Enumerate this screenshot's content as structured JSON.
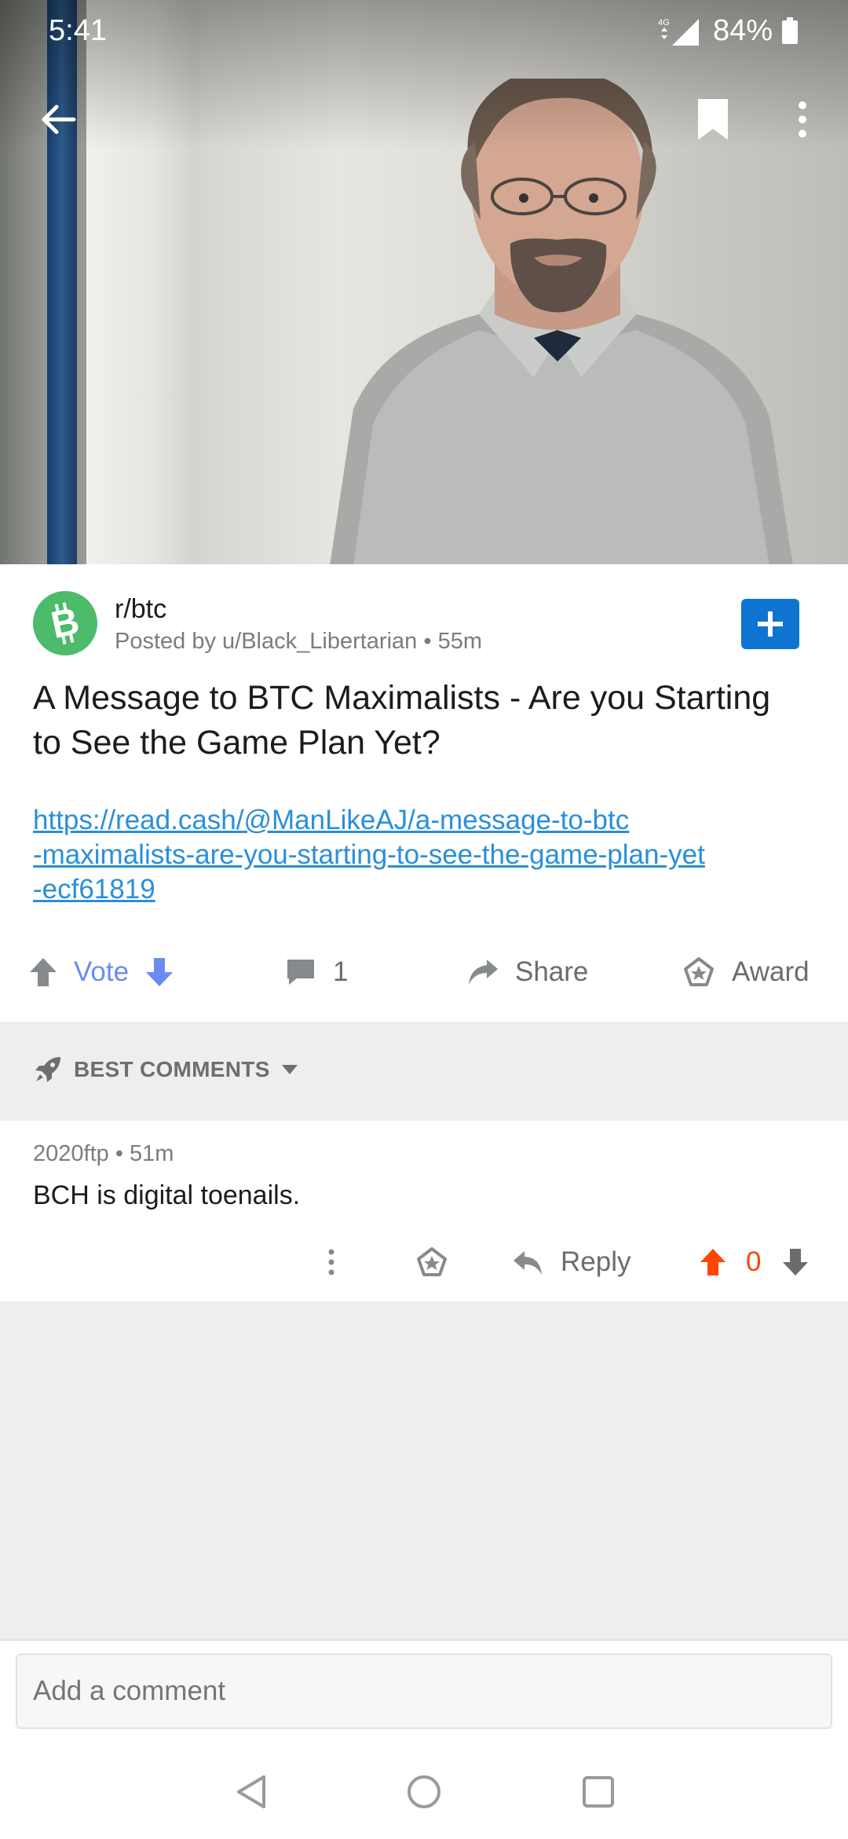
{
  "status_bar": {
    "time": "5:41",
    "network": "4G",
    "battery": "84%"
  },
  "post": {
    "subreddit": "r/btc",
    "posted_by": "Posted by u/Black_Libertarian",
    "age": "55m",
    "title": "A Message to BTC Maximalists - Are you Starting to See the Game Plan Yet?",
    "link_lines": [
      "https://read.cash/@ManLikeAJ/a-message-to-btc",
      "-maximalists-are-you-starting-to-see-the-game-plan-yet",
      "-ecf61819"
    ],
    "vote_label": "Vote",
    "comment_count": "1",
    "share_label": "Share",
    "award_label": "Award"
  },
  "sort": {
    "label": "BEST COMMENTS"
  },
  "comments": [
    {
      "author": "2020ftp",
      "age": "51m",
      "body": "BCH is digital toenails.",
      "reply_label": "Reply",
      "score": "0"
    }
  ],
  "composer": {
    "placeholder": "Add a comment"
  },
  "colors": {
    "accent_blue": "#0f74d2",
    "link": "#2a8fd9",
    "vote_blue": "#6a8bf1",
    "upvote_orange": "#ff4500",
    "subreddit_green": "#4cbc6b"
  }
}
